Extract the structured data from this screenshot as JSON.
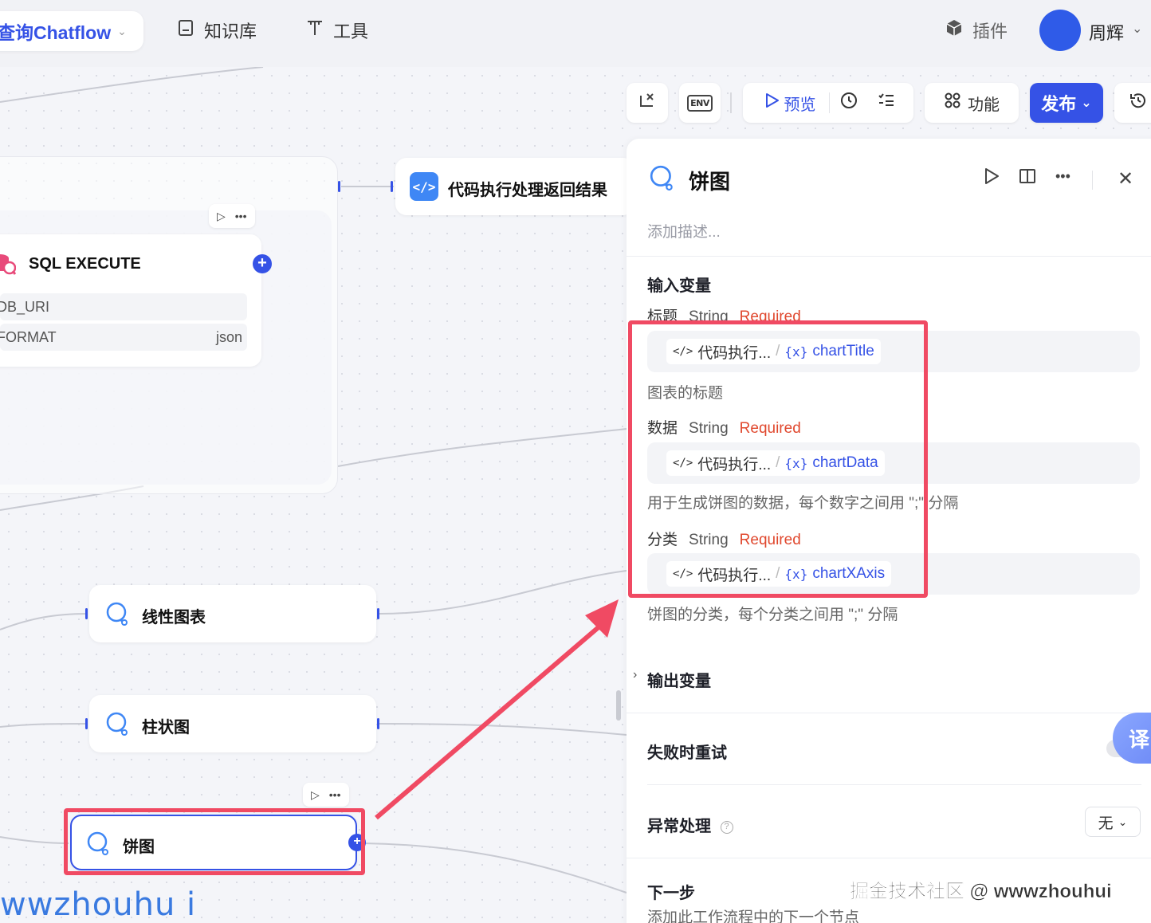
{
  "topbar": {
    "project_name": "查询Chatflow",
    "nav": [
      {
        "label": "知识库",
        "icon": "book-icon"
      },
      {
        "label": "工具",
        "icon": "tool-icon"
      }
    ],
    "plugins_label": "插件",
    "user_name": "周辉"
  },
  "toolbar": {
    "env_label": "ENV",
    "preview_label": "预览",
    "features_label": "功能",
    "publish_label": "发布"
  },
  "canvas": {
    "sql_node": {
      "title": "SQL EXECUTE",
      "params": [
        {
          "name": "DB_URI",
          "value": ""
        },
        {
          "name": "FORMAT",
          "value": "json"
        }
      ]
    },
    "code_node_title": "代码执行处理返回结果",
    "chart_nodes": [
      "线性图表",
      "柱状图",
      "饼图"
    ]
  },
  "panel": {
    "title": "饼图",
    "desc_placeholder": "添加描述...",
    "input_section": "输入变量",
    "variables": [
      {
        "name": "标题",
        "type": "String",
        "required": "Required",
        "source": "代码执行...",
        "ref": "chartTitle",
        "hint": "图表的标题"
      },
      {
        "name": "数据",
        "type": "String",
        "required": "Required",
        "source": "代码执行...",
        "ref": "chartData",
        "hint": "用于生成饼图的数据，每个数字之间用 \";\" 分隔"
      },
      {
        "name": "分类",
        "type": "String",
        "required": "Required",
        "source": "代码执行...",
        "ref": "chartXAxis",
        "hint": "饼图的分类，每个分类之间用 \";\" 分隔"
      }
    ],
    "output_section": "输出变量",
    "retry_section": "失败时重试",
    "error_section": "异常处理",
    "error_value": "无",
    "next_section": "下一步",
    "next_hint": "添加此工作流程中的下一个节点",
    "translate_label": "译"
  },
  "watermarks": {
    "left": "wwzhouhu i",
    "right": "掘金技术社区 @ wwwzhouhui"
  },
  "colors": {
    "accent": "#3552e6",
    "highlight": "#f04a63",
    "required": "#e0482e"
  }
}
